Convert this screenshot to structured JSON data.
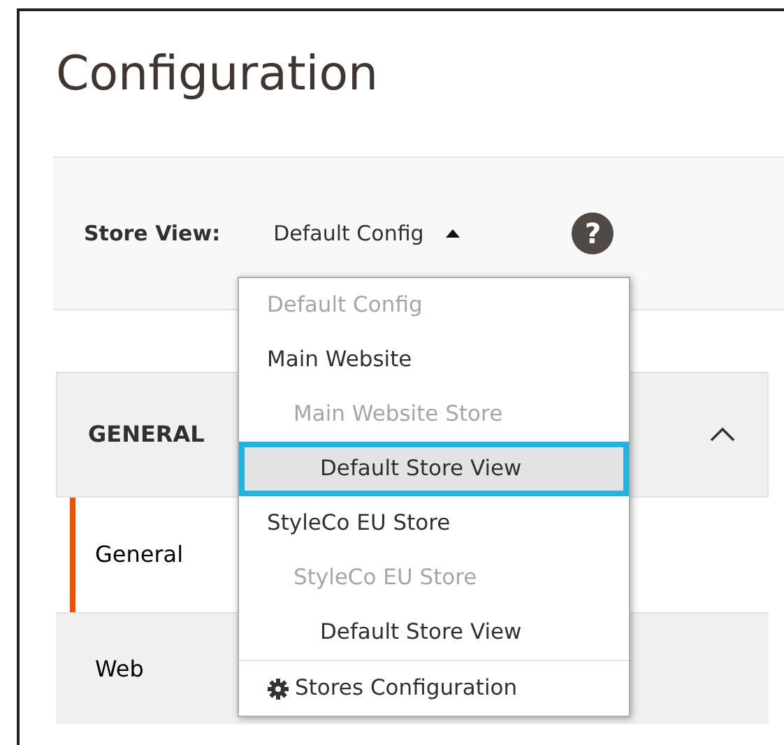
{
  "page_title": "Configuration",
  "scope": {
    "label": "Store View:",
    "value": "Default Config",
    "expanded": true,
    "help": "?"
  },
  "scope_menu": {
    "items": [
      {
        "label": "Default Config",
        "disabled": true,
        "selected": false
      },
      {
        "label": "Main Website",
        "disabled": false,
        "selected": false,
        "children": [
          {
            "label": "Main Website Store",
            "disabled": true,
            "selected": false,
            "children": [
              {
                "label": "Default Store View",
                "disabled": false,
                "selected": true
              }
            ]
          }
        ]
      },
      {
        "label": "StyleCo EU Store",
        "disabled": false,
        "selected": false,
        "children": [
          {
            "label": "StyleCo EU Store",
            "disabled": true,
            "selected": false,
            "children": [
              {
                "label": "Default Store View",
                "disabled": false,
                "selected": false
              }
            ]
          }
        ]
      }
    ],
    "footer": "Stores Configuration"
  },
  "section": {
    "title": "GENERAL",
    "expanded": true,
    "items": [
      {
        "label": "General",
        "selected": true
      },
      {
        "label": "Web",
        "selected": false
      }
    ]
  }
}
